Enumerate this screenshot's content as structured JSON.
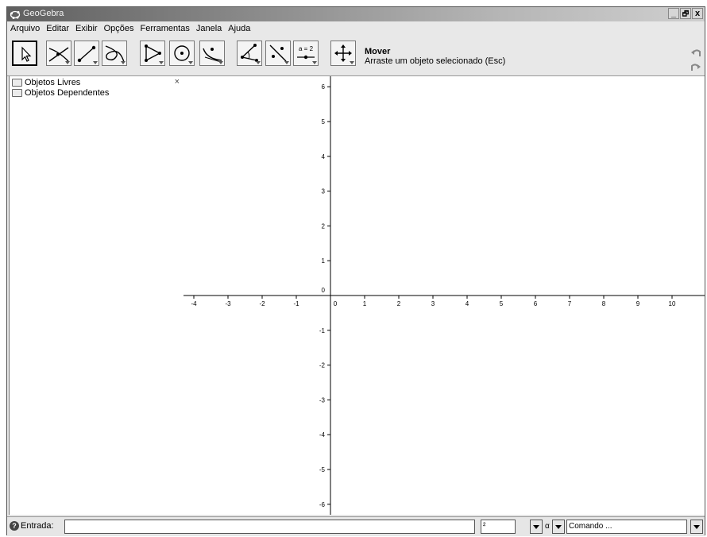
{
  "window": {
    "title": "GeoGebra",
    "controls": [
      "_",
      "🗗",
      "x"
    ]
  },
  "menu": [
    "Arquivo",
    "Editar",
    "Exibir",
    "Opções",
    "Ferramentas",
    "Janela",
    "Ajuda"
  ],
  "toolbar": {
    "tools": [
      "move-tool-icon",
      "intersect-tool-icon",
      "segment-tool-icon",
      "locus-tool-icon",
      "polygon-tool-icon",
      "circle-tool-icon",
      "conic-tool-icon",
      "angle-tool-icon",
      "reflect-tool-icon",
      "slider-tool-icon",
      "move-view-tool-icon"
    ],
    "slider_label": "a = 2",
    "active_tool_name": "Mover",
    "active_tool_help": "Arraste um objeto selecionado (Esc)"
  },
  "algebra": {
    "close": "×",
    "folders": [
      "Objetos Livres",
      "Objetos Dependentes"
    ]
  },
  "graphics": {
    "x_ticks": [
      "-4",
      "-3",
      "-2",
      "-1",
      "0",
      "1",
      "2",
      "3",
      "4",
      "5",
      "6",
      "7",
      "8",
      "9",
      "10"
    ],
    "y_ticks": [
      "6",
      "5",
      "4",
      "3",
      "2",
      "1",
      "0",
      "-1",
      "-2",
      "-3",
      "-4",
      "-5",
      "-6"
    ]
  },
  "inputbar": {
    "help": "?",
    "label": "Entrada:",
    "symbol_value": "²",
    "greek_value": "α",
    "command_value": "Comando ..."
  }
}
